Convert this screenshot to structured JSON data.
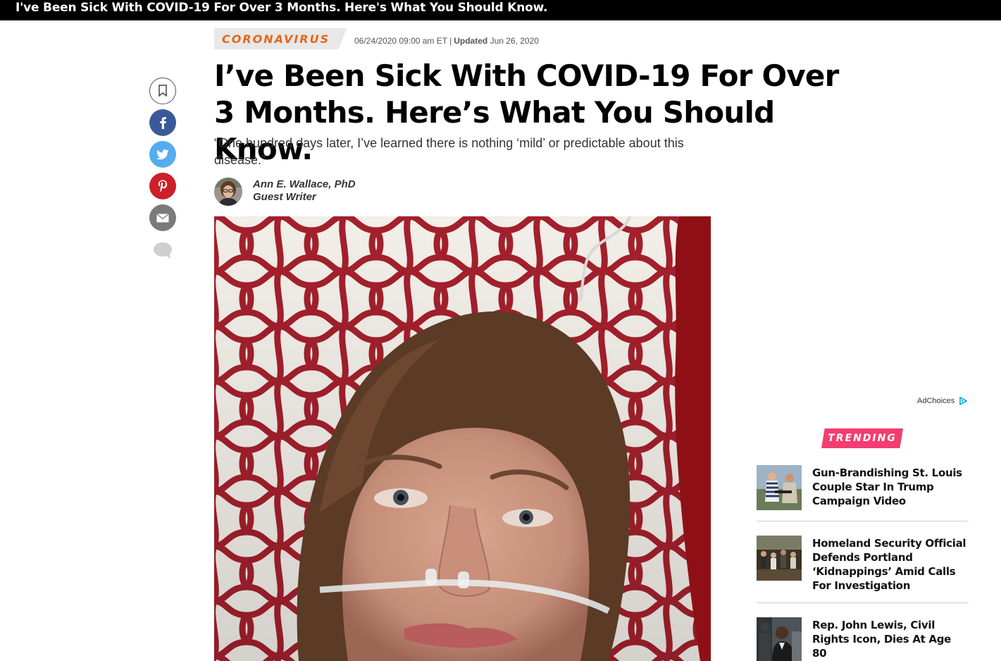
{
  "topbar": {
    "title": "I've Been Sick With COVID-19 For Over 3 Months. Here's What You Should Know."
  },
  "share": {
    "icons": [
      "bookmark-icon",
      "facebook-icon",
      "twitter-icon",
      "pinterest-icon",
      "email-icon",
      "comment-icon"
    ],
    "colors": {
      "facebook": "#3b5998",
      "twitter": "#55acee",
      "pinterest": "#cb2027",
      "email": "#7a7a7a"
    }
  },
  "article": {
    "category": "CORONAVIRUS",
    "published": "06/24/2020 09:00 am ET",
    "updated_label": "Updated",
    "updated_date": "Jun 26, 2020",
    "headline": "I’ve Been Sick With COVID-19 For Over 3 Months. Here’s What You Should Know.",
    "subhead": "“One hundred days later, I’ve learned there is nothing ‘mild’ or predictable about this disease.”",
    "author_name": "Ann E. Wallace, PhD",
    "author_role": "Guest Writer"
  },
  "ads": {
    "adchoices_label": "AdChoices"
  },
  "trending": {
    "label": "TRENDING",
    "accent": "#f43d70",
    "items": [
      {
        "title": "Gun-Brandishing St. Louis Couple Star In Trump Campaign Video"
      },
      {
        "title": "Homeland Security Official Defends Portland ‘Kidnappings’ Amid Calls For Investigation"
      },
      {
        "title": "Rep. John Lewis, Civil Rights Icon, Dies At Age 80"
      }
    ]
  },
  "colors": {
    "category_orange": "#e8641c",
    "topbar_bg": "#000000"
  }
}
